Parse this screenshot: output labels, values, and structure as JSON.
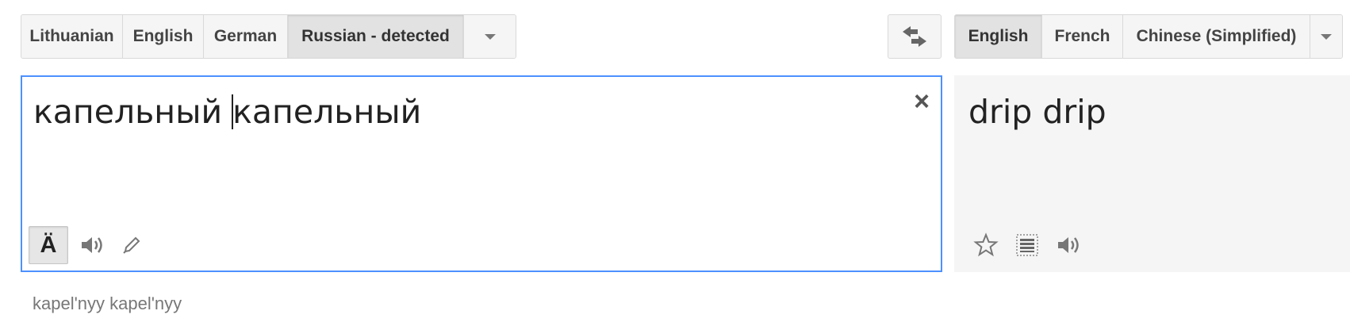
{
  "source_languages": {
    "buttons": [
      "Lithuanian",
      "English",
      "German",
      "Russian - detected"
    ],
    "selected": "Russian - detected",
    "more_icon": "chevron-down-icon"
  },
  "swap_icon": "swap-arrows-icon",
  "target_languages": {
    "buttons": [
      "English",
      "French",
      "Chinese (Simplified)"
    ],
    "selected": "English",
    "more_icon": "chevron-down-icon"
  },
  "source": {
    "text_before_caret": "капельный ",
    "text_after_caret": "капельный",
    "clear_label": "×",
    "input_tools_label": "Ä",
    "toolbar_icons": [
      "input-tools-icon",
      "speaker-icon",
      "pencil-icon"
    ]
  },
  "result": {
    "text": "drip drip",
    "toolbar_icons": [
      "star-icon",
      "list-icon",
      "speaker-icon"
    ]
  },
  "transliteration": "kapel'nyy kapel'nyy",
  "colors": {
    "focus_border": "#4d90fe",
    "button_bg": "#f5f5f5",
    "selected_bg": "#e2e2e2",
    "result_bg": "#f5f5f5"
  }
}
